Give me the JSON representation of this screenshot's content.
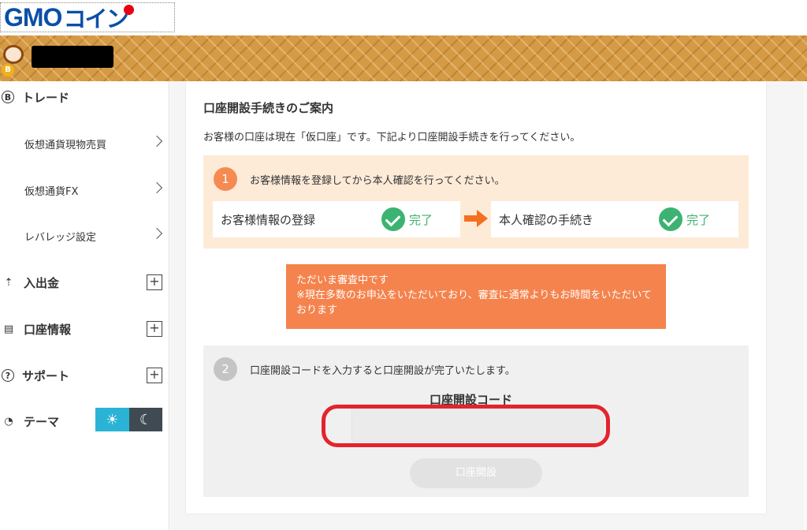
{
  "logo": {
    "gmo": "GMO",
    "coin": "コイン"
  },
  "sidebar": {
    "trade": {
      "label": "トレード",
      "icon": "bitcoin-icon"
    },
    "trade_items": [
      {
        "label": "仮想通貨現物売買"
      },
      {
        "label": "仮想通貨FX"
      },
      {
        "label": "レバレッジ設定"
      }
    ],
    "deposit": {
      "label": "入出金"
    },
    "account": {
      "label": "口座情報"
    },
    "support": {
      "label": "サポート"
    },
    "theme": {
      "label": "テーマ"
    }
  },
  "main": {
    "title": "口座開設手続きのご案内",
    "description": "お客様の口座は現在「仮口座」です。下記より口座開設手続きを行ってください。",
    "step1": {
      "number": "1",
      "text": "お客様情報を登録してから本人確認を行ってください。",
      "box1_label": "お客様情報の登録",
      "box1_status": "完了",
      "box2_label": "本人確認の手続き",
      "box2_status": "完了"
    },
    "notice": {
      "line1": "ただいま審査中です",
      "line2": "※現在多数のお申込をいただいており、審査に通常よりもお時間をいただいております"
    },
    "step2": {
      "number": "2",
      "text": "口座開設コードを入力すると口座開設が完了いたします。",
      "code_label": "口座開設コード",
      "code_value": "",
      "button_label": "口座開設"
    }
  },
  "colors": {
    "accent_orange": "#f58b52",
    "success_green": "#3cb371",
    "header_gold": "#d59a45",
    "theme_light": "#2bb3d6",
    "highlight_red": "#e3242b"
  }
}
